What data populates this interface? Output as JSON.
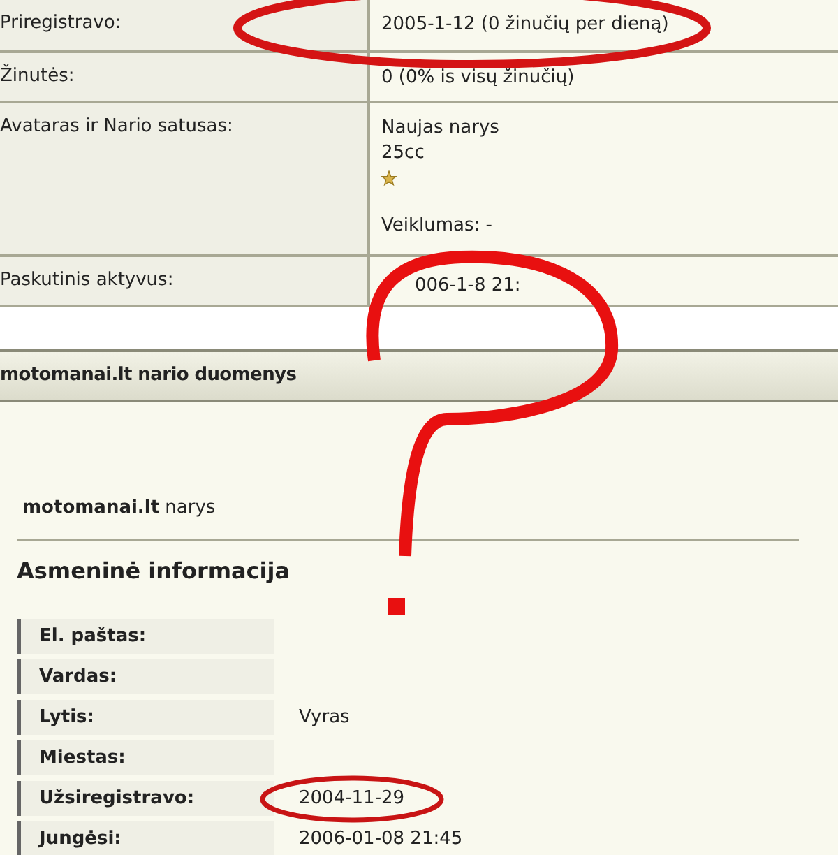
{
  "profile_rows": [
    {
      "label": "Priregistravo:",
      "items": [
        {
          "kind": "text",
          "text": "2005-1-12 (0 žinučių per dieną)"
        }
      ]
    },
    {
      "label": "Žinutės:",
      "items": [
        {
          "kind": "text",
          "text": "0 (0% is visų žinučių)"
        }
      ]
    },
    {
      "label": "Avataras ir Nario satusas:",
      "items": [
        {
          "kind": "text",
          "text": "Naujas narys"
        },
        {
          "kind": "text",
          "text": "25cc"
        },
        {
          "kind": "star"
        },
        {
          "kind": "gap"
        },
        {
          "kind": "text",
          "text": "Veiklumas: -"
        }
      ]
    },
    {
      "label": "Paskutinis aktyvus:",
      "items": [
        {
          "kind": "text",
          "text": "006-1-8 21:"
        }
      ]
    }
  ],
  "section_header": "motomanai.lt nario duomenys",
  "member_title": "**motomanai.lt** narys",
  "personal_heading": "Asmeninė informacija",
  "personal_rows": [
    {
      "label": "El. paštas:",
      "value": ""
    },
    {
      "label": "Vardas:",
      "value": ""
    },
    {
      "label": "Lytis:",
      "value": "Vyras"
    },
    {
      "label": "Miestas:",
      "value": ""
    },
    {
      "label": "Užsiregistravo:",
      "value": "2004-11-29"
    },
    {
      "label": "Jungėsi:",
      "value": "2006-01-08 21:45"
    }
  ]
}
